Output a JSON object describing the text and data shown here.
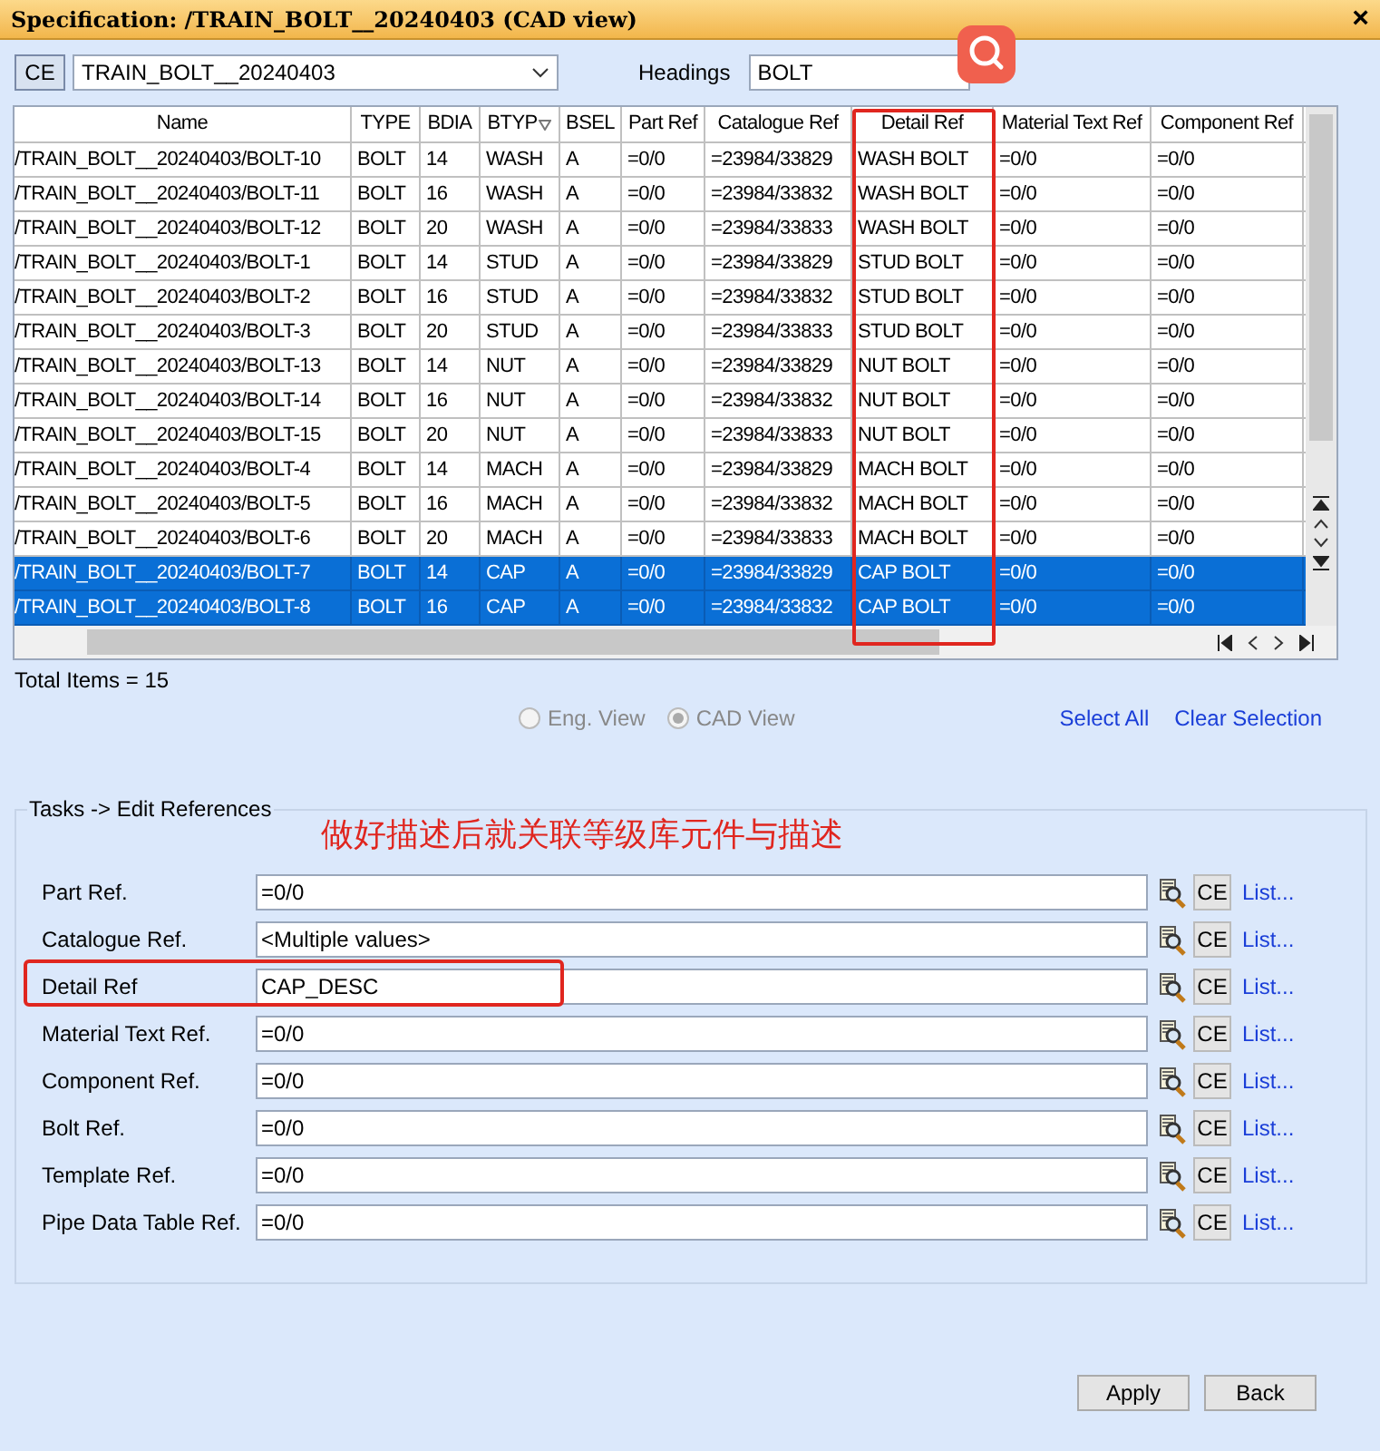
{
  "window": {
    "title": "Specification: /TRAIN_BOLT__20240403 (CAD view)",
    "close": "×"
  },
  "toolbar": {
    "ce_button": "CE",
    "spec": "TRAIN_BOLT__20240403",
    "headings_label": "Headings",
    "headings_value": "BOLT"
  },
  "table": {
    "columns": [
      "Name",
      "TYPE",
      "BDIA",
      "BTYP",
      "BSEL",
      "Part Ref",
      "Catalogue Ref",
      "Detail Ref",
      "Material Text Ref",
      "Component Ref"
    ],
    "rows": [
      {
        "cells": [
          "/TRAIN_BOLT__20240403/BOLT-10",
          "BOLT",
          "14",
          "WASH",
          "A",
          "=0/0",
          "=23984/33829",
          "WASH BOLT",
          "=0/0",
          "=0/0"
        ],
        "selected": false
      },
      {
        "cells": [
          "/TRAIN_BOLT__20240403/BOLT-11",
          "BOLT",
          "16",
          "WASH",
          "A",
          "=0/0",
          "=23984/33832",
          "WASH BOLT",
          "=0/0",
          "=0/0"
        ],
        "selected": false
      },
      {
        "cells": [
          "/TRAIN_BOLT__20240403/BOLT-12",
          "BOLT",
          "20",
          "WASH",
          "A",
          "=0/0",
          "=23984/33833",
          "WASH BOLT",
          "=0/0",
          "=0/0"
        ],
        "selected": false
      },
      {
        "cells": [
          "/TRAIN_BOLT__20240403/BOLT-1",
          "BOLT",
          "14",
          "STUD",
          "A",
          "=0/0",
          "=23984/33829",
          "STUD BOLT",
          "=0/0",
          "=0/0"
        ],
        "selected": false
      },
      {
        "cells": [
          "/TRAIN_BOLT__20240403/BOLT-2",
          "BOLT",
          "16",
          "STUD",
          "A",
          "=0/0",
          "=23984/33832",
          "STUD BOLT",
          "=0/0",
          "=0/0"
        ],
        "selected": false
      },
      {
        "cells": [
          "/TRAIN_BOLT__20240403/BOLT-3",
          "BOLT",
          "20",
          "STUD",
          "A",
          "=0/0",
          "=23984/33833",
          "STUD BOLT",
          "=0/0",
          "=0/0"
        ],
        "selected": false
      },
      {
        "cells": [
          "/TRAIN_BOLT__20240403/BOLT-13",
          "BOLT",
          "14",
          "NUT",
          "A",
          "=0/0",
          "=23984/33829",
          "NUT BOLT",
          "=0/0",
          "=0/0"
        ],
        "selected": false
      },
      {
        "cells": [
          "/TRAIN_BOLT__20240403/BOLT-14",
          "BOLT",
          "16",
          "NUT",
          "A",
          "=0/0",
          "=23984/33832",
          "NUT BOLT",
          "=0/0",
          "=0/0"
        ],
        "selected": false
      },
      {
        "cells": [
          "/TRAIN_BOLT__20240403/BOLT-15",
          "BOLT",
          "20",
          "NUT",
          "A",
          "=0/0",
          "=23984/33833",
          "NUT BOLT",
          "=0/0",
          "=0/0"
        ],
        "selected": false
      },
      {
        "cells": [
          "/TRAIN_BOLT__20240403/BOLT-4",
          "BOLT",
          "14",
          "MACH",
          "A",
          "=0/0",
          "=23984/33829",
          "MACH BOLT",
          "=0/0",
          "=0/0"
        ],
        "selected": false
      },
      {
        "cells": [
          "/TRAIN_BOLT__20240403/BOLT-5",
          "BOLT",
          "16",
          "MACH",
          "A",
          "=0/0",
          "=23984/33832",
          "MACH BOLT",
          "=0/0",
          "=0/0"
        ],
        "selected": false
      },
      {
        "cells": [
          "/TRAIN_BOLT__20240403/BOLT-6",
          "BOLT",
          "20",
          "MACH",
          "A",
          "=0/0",
          "=23984/33833",
          "MACH BOLT",
          "=0/0",
          "=0/0"
        ],
        "selected": false
      },
      {
        "cells": [
          "/TRAIN_BOLT__20240403/BOLT-7",
          "BOLT",
          "14",
          "CAP",
          "A",
          "=0/0",
          "=23984/33829",
          "CAP BOLT",
          "=0/0",
          "=0/0"
        ],
        "selected": true
      },
      {
        "cells": [
          "/TRAIN_BOLT__20240403/BOLT-8",
          "BOLT",
          "16",
          "CAP",
          "A",
          "=0/0",
          "=23984/33832",
          "CAP BOLT",
          "=0/0",
          "=0/0"
        ],
        "selected": true
      }
    ]
  },
  "total_items": "Total Items = 15",
  "view_options": [
    {
      "label": "Eng. View",
      "selected": false
    },
    {
      "label": "CAD View",
      "selected": true
    }
  ],
  "links": [
    "Select All",
    "Clear Selection"
  ],
  "tasks": {
    "title": "Tasks -> Edit References",
    "annotation": "做好描述后就关联等级库元件与描述",
    "fields": [
      {
        "label": "Part Ref.",
        "value": "=0/0",
        "ce": "CE",
        "list": "List..."
      },
      {
        "label": "Catalogue Ref.",
        "value": "<Multiple values>",
        "ce": "CE",
        "list": "List..."
      },
      {
        "label": "Detail Ref",
        "value": "CAP_DESC",
        "ce": "CE",
        "list": "List...",
        "highlighted": true
      },
      {
        "label": "Material Text Ref.",
        "value": "=0/0",
        "ce": "CE",
        "list": "List..."
      },
      {
        "label": "Component Ref.",
        "value": "=0/0",
        "ce": "CE",
        "list": "List..."
      },
      {
        "label": "Bolt Ref.",
        "value": "=0/0",
        "ce": "CE",
        "list": "List..."
      },
      {
        "label": "Template Ref.",
        "value": "=0/0",
        "ce": "CE",
        "list": "List..."
      },
      {
        "label": "Pipe Data Table Ref.",
        "value": "=0/0",
        "ce": "CE",
        "list": "List..."
      }
    ]
  },
  "buttons": [
    "Apply",
    "Back"
  ]
}
